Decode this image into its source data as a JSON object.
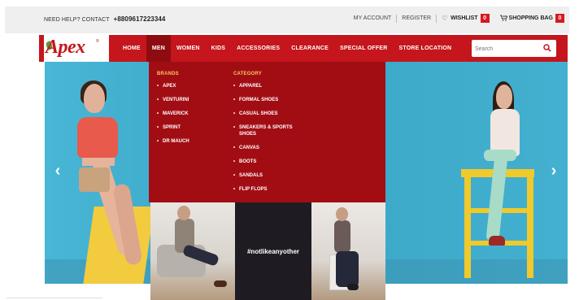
{
  "topbar": {
    "help_label": "NEED HELP? CONTACT",
    "phone": "+8809617223344",
    "my_account": "MY ACCOUNT",
    "register": "REGISTER",
    "wishlist": "WISHLIST",
    "wishlist_count": "0",
    "shopping_bag": "SHOPPING BAG",
    "bag_count": "0"
  },
  "brand": {
    "logo_text": "Apex",
    "tm": "®"
  },
  "nav": {
    "items": [
      "HOME",
      "MEN",
      "WOMEN",
      "KIDS",
      "ACCESSORIES",
      "CLEARANCE",
      "SPECIAL OFFER",
      "STORE LOCATION"
    ],
    "active": "MEN"
  },
  "search": {
    "placeholder": "Search",
    "icon": "search-icon"
  },
  "mega_menu": {
    "brands_title": "BRANDS",
    "brands": [
      "APEX",
      "VENTURINI",
      "MAVERICK",
      "SPRINT",
      "DR MAUCH"
    ],
    "category_title": "CATEGORY",
    "categories": [
      "APPAREL",
      "FORMAL SHOES",
      "CASUAL SHOES",
      "SNEAKERS & SPORTS SHOES",
      "CANVAS",
      "BOOTS",
      "SANDALS",
      "FLIP FLOPS"
    ],
    "promo_hashtag": "#notlikeanyother"
  },
  "hero": {
    "prev_icon": "chevron-left-icon",
    "next_icon": "chevron-right-icon"
  },
  "colors": {
    "brand_red": "#c4161c",
    "menu_red": "#a20d14",
    "menu_title": "#f4c85a",
    "hero_blue": "#41aece",
    "stool_yellow": "#f0c92d"
  }
}
